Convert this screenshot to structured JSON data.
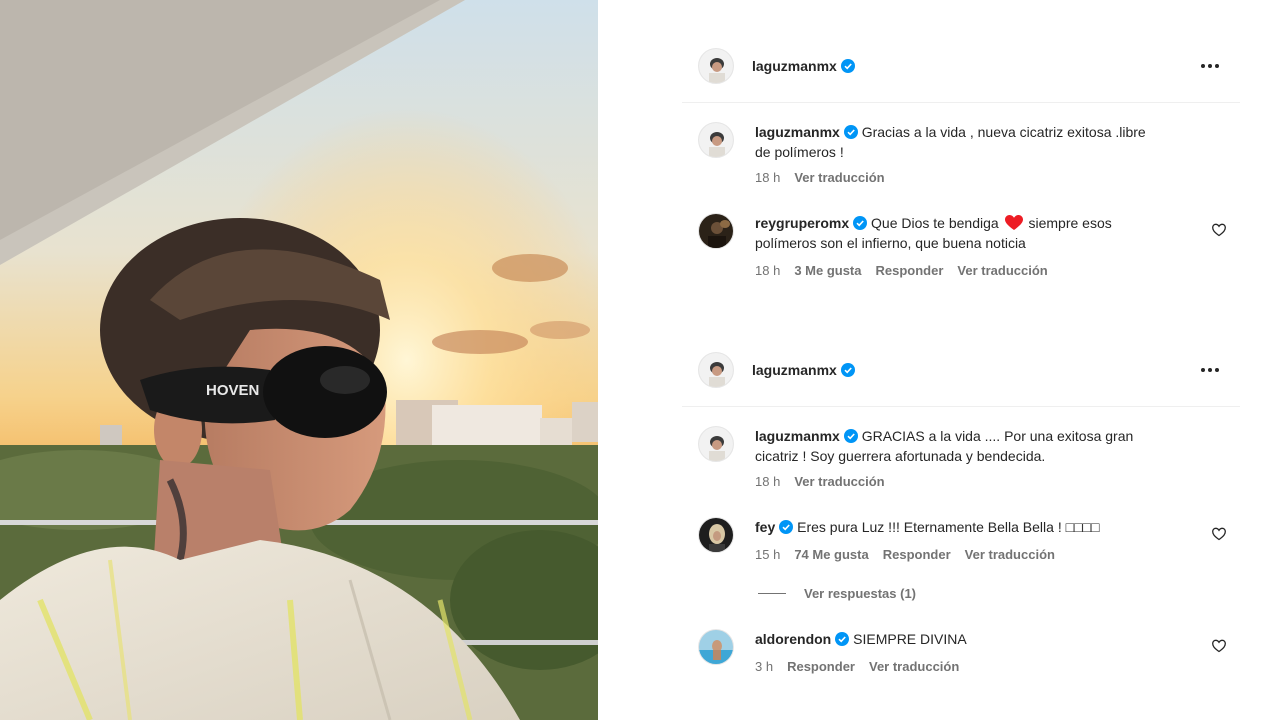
{
  "photo": {
    "sunglasses_brand": "HOVEN"
  },
  "posts": [
    {
      "header": {
        "username": "laguzmanmx",
        "verified": true
      },
      "comments": [
        {
          "username": "laguzmanmx",
          "verified": true,
          "text": "Gracias a la vida , nueva cicatriz exitosa .libre de polímeros !",
          "time": "18 h",
          "translate": "Ver traducción",
          "avatar": "owner"
        },
        {
          "username": "reygruperomx",
          "verified": true,
          "text_before": "Que Dios te bendiga",
          "emoji": "red-heart",
          "text_after": "siempre esos polímeros son el infierno, que buena noticia",
          "time": "18 h",
          "likes": "3 Me gusta",
          "reply": "Responder",
          "translate": "Ver traducción",
          "avatar": "dark"
        }
      ]
    },
    {
      "header": {
        "username": "laguzmanmx",
        "verified": true
      },
      "comments": [
        {
          "username": "laguzmanmx",
          "verified": true,
          "text": "GRACIAS a la vida .... Por una exitosa gran cicatriz ! Soy guerrera afortunada y bendecida.",
          "time": "18 h",
          "translate": "Ver traducción",
          "avatar": "owner"
        },
        {
          "username": "fey",
          "verified": true,
          "text": "Eres pura Luz !!! Eternamente Bella Bella ! □□□□",
          "time": "15 h",
          "likes": "74 Me gusta",
          "reply": "Responder",
          "translate": "Ver traducción",
          "avatar": "dark-blonde",
          "view_replies": "Ver respuestas (1)"
        },
        {
          "username": "aldorendon",
          "verified": true,
          "text": "SIEMPRE DIVINA",
          "time": "3 h",
          "reply": "Responder",
          "translate": "Ver traducción",
          "avatar": "pool"
        }
      ]
    }
  ],
  "icons": {
    "more": "more-horizontal-icon",
    "verified": "verified-badge-icon",
    "like": "heart-outline-icon"
  },
  "colors": {
    "verified_blue": "#0095f6",
    "secondary_text": "#737373",
    "heart_red": "#ed1c24"
  }
}
